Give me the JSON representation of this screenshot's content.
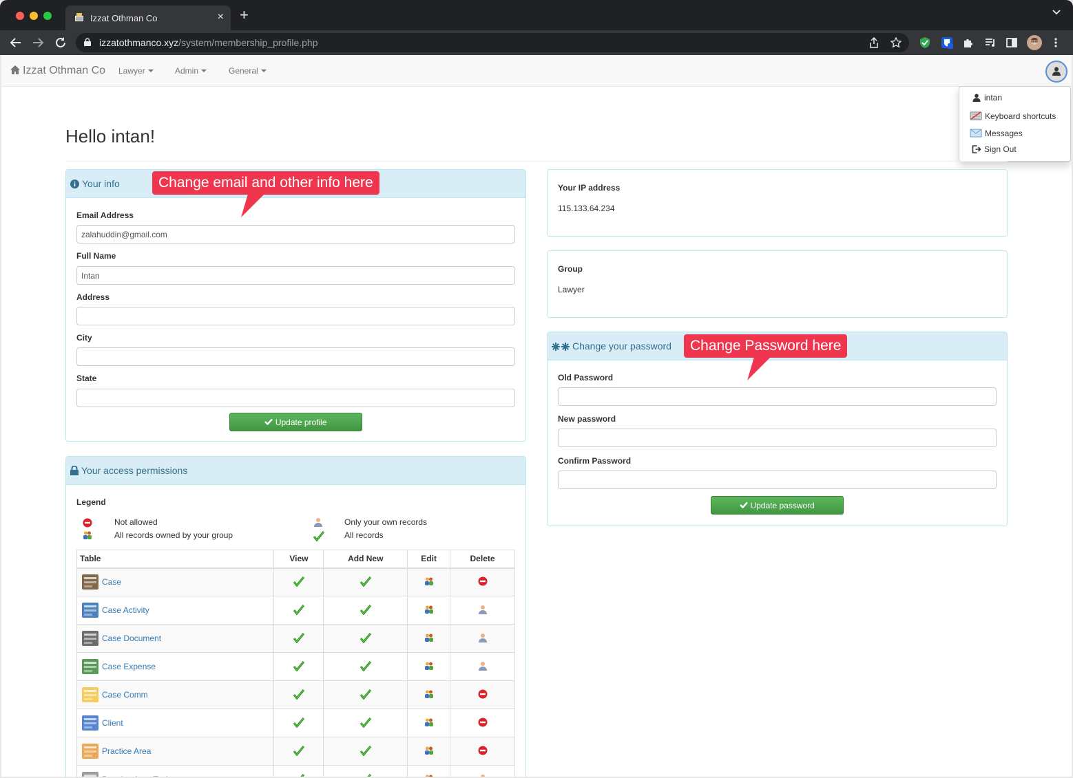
{
  "browser": {
    "tab_title": "Izzat Othman Co",
    "tab_close": "×",
    "new_tab": "+",
    "url_domain": "izzatothmanco.xyz",
    "url_path": "/system/membership_profile.php"
  },
  "navbar": {
    "brand": "Izzat Othman Co",
    "menus": [
      "Lawyer",
      "Admin",
      "General"
    ]
  },
  "user_menu": {
    "items": [
      "intan",
      "Keyboard shortcuts",
      "Messages",
      "Sign Out"
    ]
  },
  "page": {
    "greeting": "Hello intan!"
  },
  "your_info": {
    "heading": "Your info",
    "callout": "Change email and other info here",
    "fields": [
      {
        "label": "Email Address",
        "value": "zalahuddin@gmail.com"
      },
      {
        "label": "Full Name",
        "value": "Intan"
      },
      {
        "label": "Address",
        "value": ""
      },
      {
        "label": "City",
        "value": ""
      },
      {
        "label": "State",
        "value": ""
      }
    ],
    "button": "Update profile"
  },
  "ip_panel": {
    "label": "Your IP address",
    "value": "115.133.64.234"
  },
  "group_panel": {
    "label": "Group",
    "value": "Lawyer"
  },
  "password": {
    "heading": "Change your password",
    "callout": "Change Password here",
    "fields": [
      "Old Password",
      "New password",
      "Confirm Password"
    ],
    "button": "Update password"
  },
  "permissions": {
    "heading": "Your access permissions",
    "legend_title": "Legend",
    "legend": [
      {
        "icon": "not-allowed-icon",
        "text": "Not allowed"
      },
      {
        "icon": "group-records-icon",
        "text": "All records owned by your group"
      },
      {
        "icon": "own-records-icon",
        "text": "Only your own records"
      },
      {
        "icon": "all-records-icon",
        "text": "All records"
      }
    ],
    "columns": [
      "Table",
      "View",
      "Add New",
      "Edit",
      "Delete"
    ],
    "rows": [
      {
        "name": "Case",
        "view": "all",
        "add": "all",
        "edit": "group",
        "delete": "none"
      },
      {
        "name": "Case Activity",
        "view": "all",
        "add": "all",
        "edit": "group",
        "delete": "own"
      },
      {
        "name": "Case Document",
        "view": "all",
        "add": "all",
        "edit": "group",
        "delete": "own"
      },
      {
        "name": "Case Expense",
        "view": "all",
        "add": "all",
        "edit": "group",
        "delete": "own"
      },
      {
        "name": "Case Comm",
        "view": "all",
        "add": "all",
        "edit": "group",
        "delete": "none"
      },
      {
        "name": "Client",
        "view": "all",
        "add": "all",
        "edit": "group",
        "delete": "none"
      },
      {
        "name": "Practice Area",
        "view": "all",
        "add": "all",
        "edit": "group",
        "delete": "none"
      },
      {
        "name": "Practice Area Task",
        "view": "all",
        "add": "all",
        "edit": "group",
        "delete": "own"
      }
    ]
  },
  "colors": {
    "panel_heading_bg": "#d9edf7",
    "panel_heading_text": "#31708f",
    "callout": "#f0364f",
    "success": "#5cb85c",
    "link": "#337ab7"
  }
}
